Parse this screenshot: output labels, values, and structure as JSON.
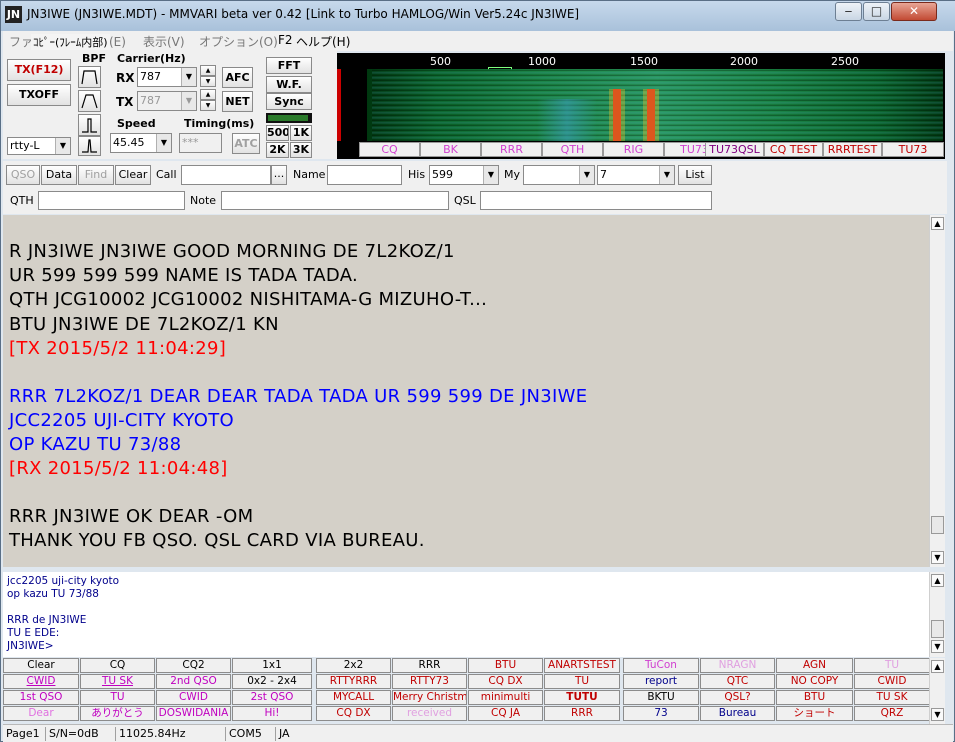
{
  "title": {
    "text": "JN3IWE (JN3IWE.MDT) - MMVARI beta ver 0.42 [Link to Turbo HAMLOG/Win Ver5.24c JN3IWE]",
    "icon": "JN",
    "controls": {
      "minimize": "‒",
      "maximize": "□",
      "close": "✕"
    }
  },
  "menubar": {
    "items": [
      "ファイル(F)",
      "編集(E)",
      "表示(V)",
      "オプション(O)",
      "ヘルプ(H)"
    ],
    "copy_popup": "ｺﾋﾟｰ(ﾌﾚｰﾑ内部)",
    "f2": "F2"
  },
  "controls": {
    "tx": "TX(F12)",
    "txoff": "TXOFF",
    "mode": "rtty-L",
    "bpf_label": "BPF",
    "carrier_label": "Carrier(Hz)",
    "rx_label": "RX",
    "rx_value": "787",
    "tx_label": "TX",
    "tx_value": "787",
    "afc": "AFC",
    "net": "NET",
    "speed_label": "Speed",
    "speed_value": "45.45",
    "timing_label": "Timing(ms)",
    "timing_value": "***",
    "atc": "ATC",
    "fft": "FFT",
    "wf": "W.F.",
    "sync": "Sync",
    "b500": "500",
    "b1k": "1K",
    "b2k": "2K",
    "b3k": "3K"
  },
  "spectrum": {
    "freq_labels": [
      "500",
      "1000",
      "1500",
      "2000",
      "2500"
    ]
  },
  "macros": [
    {
      "label": "CQ",
      "color": "#d040d0"
    },
    {
      "label": "BK",
      "color": "#d040d0"
    },
    {
      "label": "RRR",
      "color": "#d040d0"
    },
    {
      "label": "QTH",
      "color": "#d040d0"
    },
    {
      "label": "RIG",
      "color": "#d040d0"
    },
    {
      "label": "TU73",
      "color": "#d040d0"
    },
    {
      "label": "TU73QSL",
      "color": "#800080"
    },
    {
      "label": "CQ TEST",
      "color": "#c00000"
    },
    {
      "label": "RRRTEST",
      "color": "#c00000"
    },
    {
      "label": "TU73",
      "color": "#c00000"
    }
  ],
  "log": {
    "qso": "QSO",
    "data": "Data",
    "find": "Find",
    "clear": "Clear",
    "call_label": "Call",
    "call_value": "",
    "ellipsis": "...",
    "name_label": "Name",
    "name_value": "",
    "his_label": "His",
    "his_value": "599",
    "my_label": "My",
    "my_value": "",
    "seven": "7",
    "list": "List",
    "qth_label": "QTH",
    "note_label": "Note",
    "qsl_label": "QSL"
  },
  "rx_lines": [
    {
      "text": "R JN3IWE JN3IWE GOOD MORNING DE 7L2KOZ/1",
      "color": "#000000"
    },
    {
      "text": "UR 599 599 599 NAME IS TADA TADA.",
      "color": "#000000"
    },
    {
      "text": "QTH JCG10002 JCG10002 NISHITAMA-G MIZUHO-T...",
      "color": "#000000"
    },
    {
      "text": "BTU JN3IWE DE 7L2KOZ/1 KN",
      "color": "#000000"
    },
    {
      "text": "[TX 2015/5/2 11:04:29]",
      "color": "#ff0000"
    },
    {
      "text": "",
      "color": "#000000"
    },
    {
      "text": "RRR 7L2KOZ/1 DEAR DEAR TADA TADA UR 599 599 DE JN3IWE",
      "color": "#0000ff"
    },
    {
      "text": "JCC2205 UJI-CITY KYOTO",
      "color": "#0000ff"
    },
    {
      "text": "OP KAZU TU 73/88",
      "color": "#0000ff"
    },
    {
      "text": "[RX 2015/5/2 11:04:48]",
      "color": "#ff0000"
    },
    {
      "text": "",
      "color": "#000000"
    },
    {
      "text": "RRR JN3IWE OK DEAR -OM",
      "color": "#000000"
    },
    {
      "text": "THANK YOU FB QSO. QSL CARD  VIA BUREAU.",
      "color": "#000000"
    }
  ],
  "tx_lines": [
    "jcc2205 uji-city kyoto",
    "op kazu TU 73/88",
    "",
    "RRR  de JN3IWE",
    "TU E EDE:",
    "JN3IWE>"
  ],
  "grid": [
    [
      {
        "t": "Clear",
        "c": "#000000"
      },
      {
        "t": "CQ",
        "c": "#000000"
      },
      {
        "t": "CQ2",
        "c": "#000000"
      },
      {
        "t": "1x1",
        "c": "#000000"
      },
      {
        "t": "2x2",
        "c": "#000000"
      },
      {
        "t": "RRR",
        "c": "#000000"
      },
      {
        "t": "BTU",
        "c": "#c00000"
      },
      {
        "t": "ANARTSTEST",
        "c": "#c00000"
      },
      {
        "t": "TuCon",
        "c": "#d040d0"
      },
      {
        "t": "NRAGN",
        "c": "#e0a0e0"
      },
      {
        "t": "AGN",
        "c": "#c00000"
      },
      {
        "t": "TU",
        "c": "#e0a0e0"
      }
    ],
    [
      {
        "t": "CWID",
        "c": "#c000c0",
        "u": true
      },
      {
        "t": "TU SK",
        "c": "#c000c0",
        "u": true
      },
      {
        "t": "2nd QSO",
        "c": "#c000c0"
      },
      {
        "t": "0x2 - 2x4",
        "c": "#000000"
      },
      {
        "t": "RTTYRRR",
        "c": "#c00000"
      },
      {
        "t": "RTTY73",
        "c": "#c00000"
      },
      {
        "t": "CQ DX",
        "c": "#c00000"
      },
      {
        "t": "TU",
        "c": "#c00000"
      },
      {
        "t": "report",
        "c": "#00008b"
      },
      {
        "t": "QTC",
        "c": "#c00000"
      },
      {
        "t": "NO COPY",
        "c": "#c00000"
      },
      {
        "t": "CWID",
        "c": "#c00000"
      }
    ],
    [
      {
        "t": "1st QSO",
        "c": "#c000c0"
      },
      {
        "t": "TU",
        "c": "#c000c0"
      },
      {
        "t": "CWID",
        "c": "#c000c0"
      },
      {
        "t": "2st QSO",
        "c": "#c000c0"
      },
      {
        "t": "MYCALL",
        "c": "#c00000"
      },
      {
        "t": "Merry Christmas",
        "c": "#c00000"
      },
      {
        "t": "minimulti",
        "c": "#c00000"
      },
      {
        "t": "TUTU",
        "c": "#c00000",
        "b": true
      },
      {
        "t": "BKTU",
        "c": "#000000"
      },
      {
        "t": "QSL?",
        "c": "#c00000"
      },
      {
        "t": "BTU",
        "c": "#c00000"
      },
      {
        "t": "TU SK",
        "c": "#c00000"
      }
    ],
    [
      {
        "t": "Dear",
        "c": "#e070e0"
      },
      {
        "t": "ありがとう",
        "c": "#c000c0"
      },
      {
        "t": "DOSWIDANIA",
        "c": "#c000c0"
      },
      {
        "t": "Hi!",
        "c": "#c000c0"
      },
      {
        "t": "CQ DX",
        "c": "#c00000"
      },
      {
        "t": "received",
        "c": "#e0a0e0"
      },
      {
        "t": "CQ JA",
        "c": "#c00000"
      },
      {
        "t": "RRR",
        "c": "#c00000"
      },
      {
        "t": "73",
        "c": "#00008b"
      },
      {
        "t": "Bureau",
        "c": "#00008b"
      },
      {
        "t": "ショート",
        "c": "#c00000"
      },
      {
        "t": "QRZ",
        "c": "#c00000"
      }
    ]
  ],
  "status": [
    "Page1",
    "S/N=0dB",
    "11025.84Hz",
    "COM5",
    "JA"
  ]
}
